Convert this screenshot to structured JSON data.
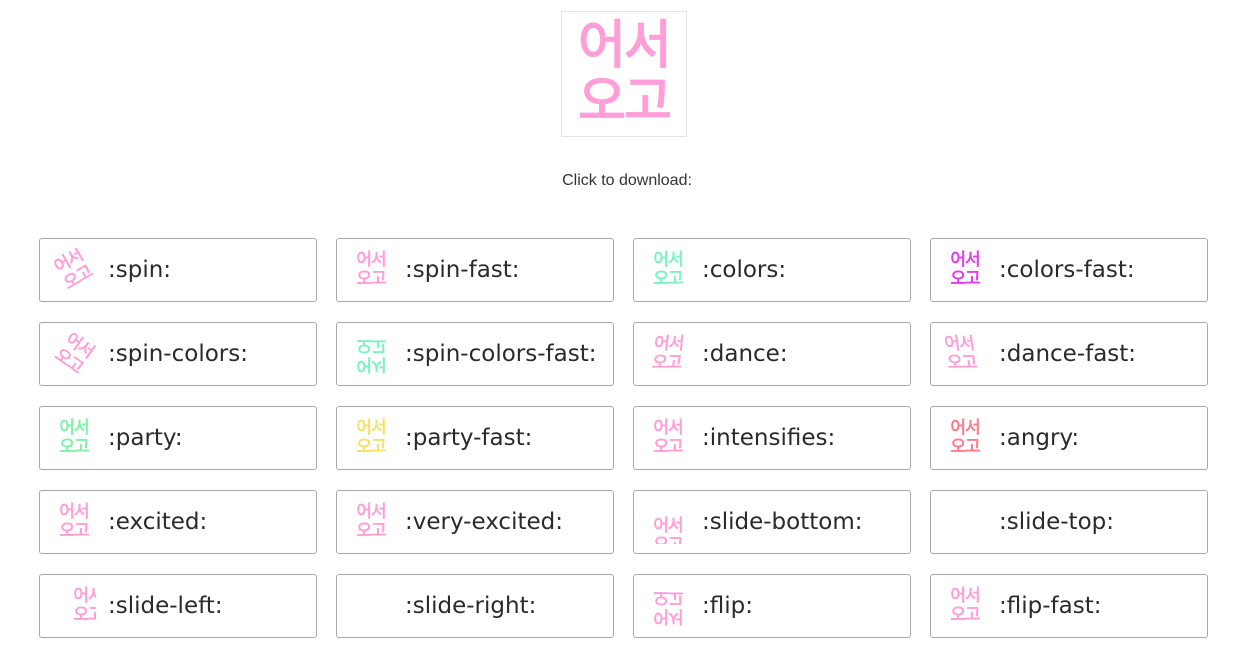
{
  "preview": {
    "top_line": "어서",
    "bottom_line": "오고",
    "color": "#ff9ed8"
  },
  "caption": "Click to download:",
  "emoji_text": {
    "top_line": "어서",
    "bottom_line": "오고"
  },
  "emojis": [
    {
      "label": ":spin:",
      "color": "#ff9ed8",
      "effect": "spin"
    },
    {
      "label": ":spin-fast:",
      "color": "#ff9ed8",
      "effect": "none"
    },
    {
      "label": ":colors:",
      "color": "#7df2c4",
      "effect": "none"
    },
    {
      "label": ":colors-fast:",
      "color": "#e23cf0",
      "effect": "none"
    },
    {
      "label": ":spin-colors:",
      "color": "#ff9ed8",
      "effect": "spin-colors"
    },
    {
      "label": ":spin-colors-fast:",
      "color": "#7df2c4",
      "effect": "spin-colors-fast"
    },
    {
      "label": ":dance:",
      "color": "#ff9ed8",
      "effect": "dance"
    },
    {
      "label": ":dance-fast:",
      "color": "#ff9ed8",
      "effect": "dance-fast"
    },
    {
      "label": ":party:",
      "color": "#7df2a8",
      "effect": "none"
    },
    {
      "label": ":party-fast:",
      "color": "#f7e06a",
      "effect": "none"
    },
    {
      "label": ":intensifies:",
      "color": "#ff9ed8",
      "effect": "none"
    },
    {
      "label": ":angry:",
      "color": "#ff7a8a",
      "effect": "none"
    },
    {
      "label": ":excited:",
      "color": "#ff9ed8",
      "effect": "none"
    },
    {
      "label": ":very-excited:",
      "color": "#ff9ed8",
      "effect": "none"
    },
    {
      "label": ":slide-bottom:",
      "color": "#ff9ed8",
      "effect": "slide-bottom"
    },
    {
      "label": ":slide-top:",
      "color": "#ff9ed8",
      "effect": "slide-top"
    },
    {
      "label": ":slide-left:",
      "color": "#ff9ed8",
      "effect": "slide-left"
    },
    {
      "label": ":slide-right:",
      "color": "#ff9ed8",
      "effect": "slide-right"
    },
    {
      "label": ":flip:",
      "color": "#ff9ed8",
      "effect": "flip"
    },
    {
      "label": ":flip-fast:",
      "color": "#ff9ed8",
      "effect": "none"
    }
  ]
}
